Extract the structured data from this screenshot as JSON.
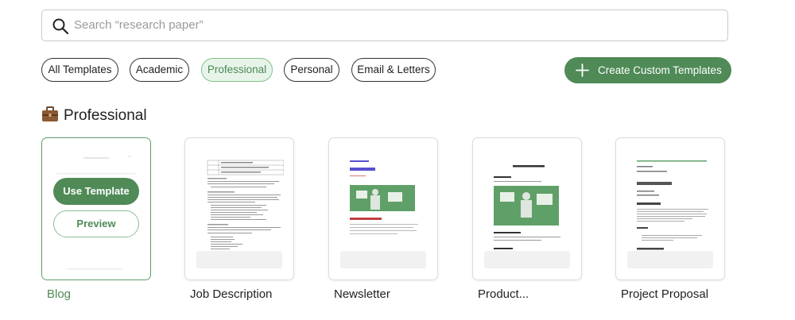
{
  "search": {
    "placeholder": "Search “research paper”",
    "value": ""
  },
  "filters": [
    {
      "label": "All Templates",
      "active": false
    },
    {
      "label": "Academic",
      "active": false
    },
    {
      "label": "Professional",
      "active": true
    },
    {
      "label": "Personal",
      "active": false
    },
    {
      "label": "Email & Letters",
      "active": false
    }
  ],
  "create_button": {
    "label": "Create Custom Templates",
    "icon": "plus-icon"
  },
  "section": {
    "title": "Professional",
    "icon": "briefcase-icon"
  },
  "cards": [
    {
      "label": "Blog",
      "selected": true,
      "use_label": "Use Template",
      "preview_label": "Preview"
    },
    {
      "label": "Job Description",
      "selected": false
    },
    {
      "label": "Newsletter",
      "selected": false
    },
    {
      "label": "Product...",
      "selected": false
    },
    {
      "label": "Project Proposal",
      "selected": false
    }
  ],
  "colors": {
    "accent": "#4f8a57",
    "accent_light": "#e8f4ea",
    "border": "#c9c9c9"
  }
}
